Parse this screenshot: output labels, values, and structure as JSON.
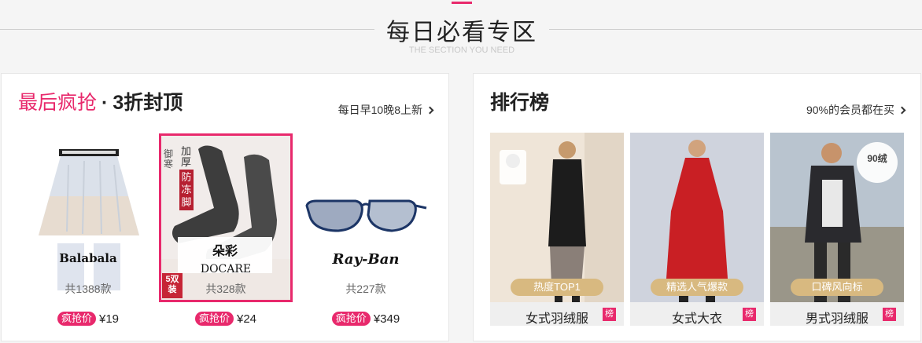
{
  "header": {
    "title": "每日必看专区",
    "subtitle": "THE SECTION YOU NEED"
  },
  "flash": {
    "title_highlight": "最后疯抢",
    "title_sep": "·",
    "title_rest": "3折封顶",
    "more": "每日早10晚8上新",
    "items": [
      {
        "brand": "Balabala",
        "count": "共1388款",
        "tag": "疯抢价",
        "price": "¥19"
      },
      {
        "brand": "DOCARE",
        "brand_cn": "朵彩",
        "badge_top": "加厚",
        "badge_side": "御寒",
        "badge_red": "防冻脚",
        "badge_corner": "5双装",
        "count": "共328款",
        "tag": "疯抢价",
        "price": "¥24"
      },
      {
        "brand": "Ray-Ban",
        "count": "共227款",
        "tag": "疯抢价",
        "price": "¥349"
      }
    ]
  },
  "ranking": {
    "title": "排行榜",
    "more": "90%的会员都在买",
    "items": [
      {
        "pill": "热度TOP1",
        "name": "女式羽绒服",
        "badge": "榜"
      },
      {
        "pill": "精选人气爆款",
        "name": "女式大衣",
        "badge": "榜"
      },
      {
        "pill": "口碑风向标",
        "name": "男式羽绒服",
        "badge": "榜",
        "stamp": "90绒"
      }
    ]
  },
  "colors": {
    "accent": "#e8296c",
    "gold": "#d8b980"
  }
}
